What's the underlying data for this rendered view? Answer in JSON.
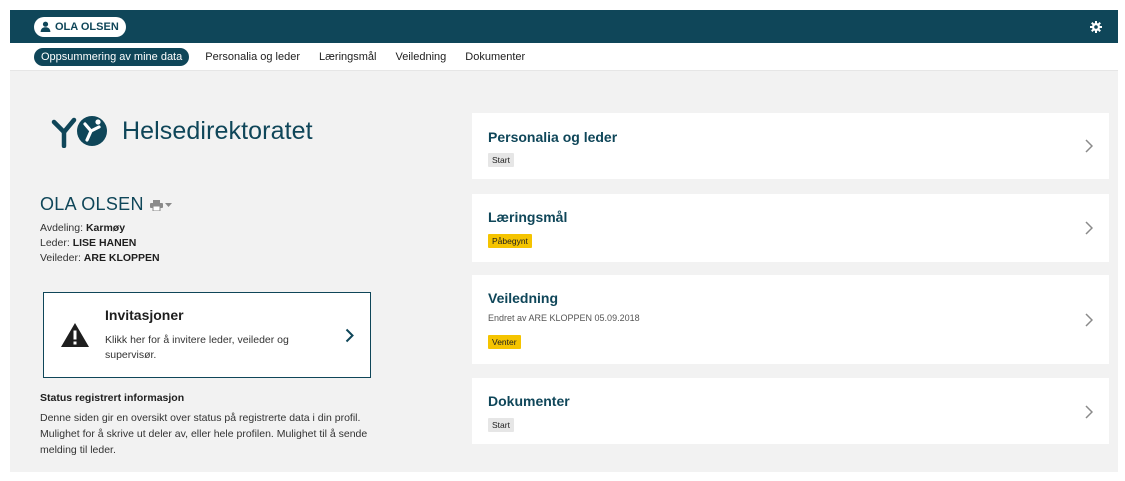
{
  "user": {
    "name": "OLA OLSEN"
  },
  "tabs": [
    {
      "label": "Oppsummering av mine data",
      "active": true
    },
    {
      "label": "Personalia og leder"
    },
    {
      "label": "Læringsmål"
    },
    {
      "label": "Veiledning"
    },
    {
      "label": "Dokumenter"
    }
  ],
  "logo": {
    "text": "Helsedirektoratet"
  },
  "person": {
    "name": "OLA OLSEN",
    "department_label": "Avdeling:",
    "department": "Karmøy",
    "leader_label": "Leder:",
    "leader": "LISE HANEN",
    "supervisor_label": "Veileder:",
    "supervisor": "ARE KLOPPEN"
  },
  "invite": {
    "title": "Invitasjoner",
    "description": "Klikk her for å invitere leder, veileder og supervisør."
  },
  "status": {
    "heading": "Status registrert informasjon",
    "text": "Denne siden gir en oversikt over status på registrerte data i din profil. Mulighet for å skrive ut deler av, eller hele profilen. Mulighet til å sende melding til leder."
  },
  "cards": [
    {
      "title": "Personalia og leder",
      "badge": "Start",
      "badge_color": "#e6e6e6"
    },
    {
      "title": "Læringsmål",
      "badge": "Påbegynt",
      "badge_color": "#f5c400"
    },
    {
      "title": "Veiledning",
      "subtitle": "Endret av ARE KLOPPEN 05.09.2018",
      "badge": "Venter",
      "badge_color": "#f5c400"
    },
    {
      "title": "Dokumenter",
      "badge": "Start",
      "badge_color": "#e6e6e6"
    }
  ],
  "colors": {
    "brand": "#0f4659",
    "status_yellow": "#f5c400",
    "status_grey": "#e6e6e6"
  },
  "icons": [
    "user-icon",
    "gear-icon",
    "print-icon",
    "caret-down-icon",
    "warning-icon",
    "chevron-right-icon",
    "helsedirektoratet-logo"
  ]
}
